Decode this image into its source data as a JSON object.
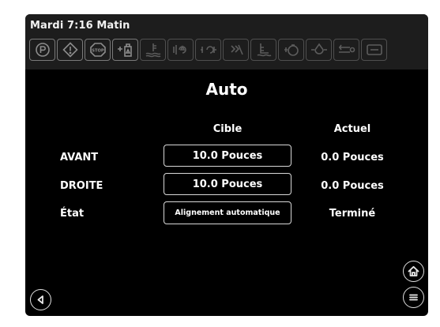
{
  "header": {
    "clock": "Mardi 7:16 Matin"
  },
  "toolbar": {
    "icons": [
      "park-brake-icon",
      "warning-icon",
      "stop-icon",
      "fuel-filter-icon",
      "coolant-level-icon",
      "transmission-icon",
      "hydraulic-icon",
      "steering-icon",
      "engine-oil-icon",
      "oil-temperature-icon",
      "oil-pressure-icon",
      "air-filter-icon",
      "service-icon"
    ],
    "stop_label": "STOP"
  },
  "main": {
    "title": "Auto",
    "col_target": "Cible",
    "col_actual": "Actuel",
    "rows": [
      {
        "label": "AVANT",
        "target": "10.0 Pouces",
        "actual": "0.0 Pouces"
      },
      {
        "label": "DROITE",
        "target": "10.0 Pouces",
        "actual": "0.0 Pouces"
      },
      {
        "label": "État",
        "target": "Alignement automatique",
        "actual": "Terminé"
      }
    ]
  },
  "colors": {
    "background": "#000000",
    "topbar": "#1d1d1d",
    "text": "#ffffff",
    "icon": "#8c8c8c"
  }
}
